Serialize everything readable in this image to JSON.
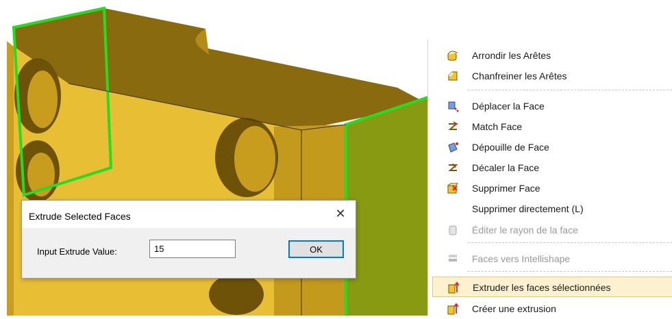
{
  "dialog": {
    "title": "Extrude Selected Faces",
    "close_glyph": "✕",
    "input_label": "Input Extrude Value:",
    "input_value": "15",
    "ok_label": "OK"
  },
  "context_menu": {
    "items": [
      {
        "label": "Arrondir les Arêtes",
        "icon": "round-edges-icon",
        "state": "enabled"
      },
      {
        "label": "Chanfreiner les Arêtes",
        "icon": "chamfer-edges-icon",
        "state": "enabled"
      },
      {
        "label": "Déplacer la Face",
        "icon": "move-face-icon",
        "state": "enabled"
      },
      {
        "label": "Match Face",
        "icon": "match-face-icon",
        "state": "enabled"
      },
      {
        "label": "Dépouille de Face",
        "icon": "draft-face-icon",
        "state": "enabled"
      },
      {
        "label": "Décaler la Face",
        "icon": "offset-face-icon",
        "state": "enabled"
      },
      {
        "label": "Supprimer Face",
        "icon": "delete-face-icon",
        "state": "enabled"
      },
      {
        "label": "Supprimer directement (L)",
        "icon": "",
        "state": "enabled"
      },
      {
        "label": "Éditer le rayon de la face",
        "icon": "edit-face-radius-icon",
        "state": "disabled"
      },
      {
        "label": "Faces vers Intellishape",
        "icon": "faces-to-intellishape-icon",
        "state": "disabled"
      },
      {
        "label": "Extruder les faces sélectionnées",
        "icon": "extrude-faces-icon",
        "state": "highlighted"
      },
      {
        "label": "Créer une extrusion",
        "icon": "create-extrusion-icon",
        "state": "enabled"
      }
    ]
  },
  "colors": {
    "part_face": "#e8be34",
    "part_dark": "#8b6d10",
    "selection": "#22dd22",
    "menu_highlight": "#fdf1cf"
  }
}
